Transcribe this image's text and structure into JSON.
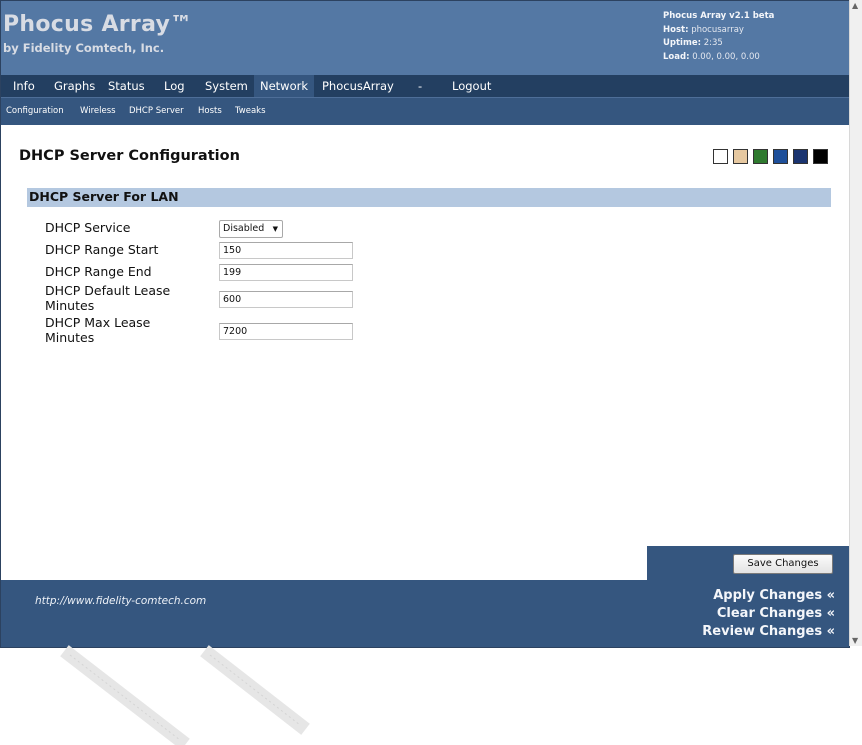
{
  "header": {
    "title": "Phocus Array™",
    "subtitle": "by Fidelity Comtech, Inc.",
    "status": {
      "version": "Phocus Array v2.1 beta",
      "host_label": "Host:",
      "host_value": "phocusarray",
      "uptime_label": "Uptime:",
      "uptime_value": "2:35",
      "load_label": "Load:",
      "load_value": "0.00, 0.00, 0.00"
    }
  },
  "nav": {
    "main": [
      "Info",
      "Graphs",
      "Status",
      "Log",
      "System",
      "Network",
      "PhocusArray",
      "-",
      "Logout"
    ],
    "active": "Network",
    "sub": [
      "Configuration",
      "Wireless",
      "DHCP Server",
      "Hosts",
      "Tweaks"
    ]
  },
  "page": {
    "title": "DHCP Server Configuration",
    "swatches": [
      "#ffffff",
      "#e6c8a0",
      "#2f7a2f",
      "#1e4f9a",
      "#1a3470",
      "#000000"
    ]
  },
  "section": {
    "title": "DHCP Server For LAN",
    "fields": {
      "service": {
        "label": "DHCP Service",
        "value": "Disabled"
      },
      "range_start": {
        "label": "DHCP Range Start",
        "value": "150"
      },
      "range_end": {
        "label": "DHCP Range End",
        "value": "199"
      },
      "default_lease": {
        "label_line1": "DHCP Default Lease",
        "label_line2": "Minutes",
        "value": "600"
      },
      "max_lease": {
        "label_line1": "DHCP Max Lease",
        "label_line2": "Minutes",
        "value": "7200"
      }
    }
  },
  "footer": {
    "save_button": "Save Changes",
    "url": "http://www.fidelity-comtech.com",
    "apply": "Apply Changes «",
    "clear": "Clear Changes «",
    "review": "Review Changes «"
  }
}
